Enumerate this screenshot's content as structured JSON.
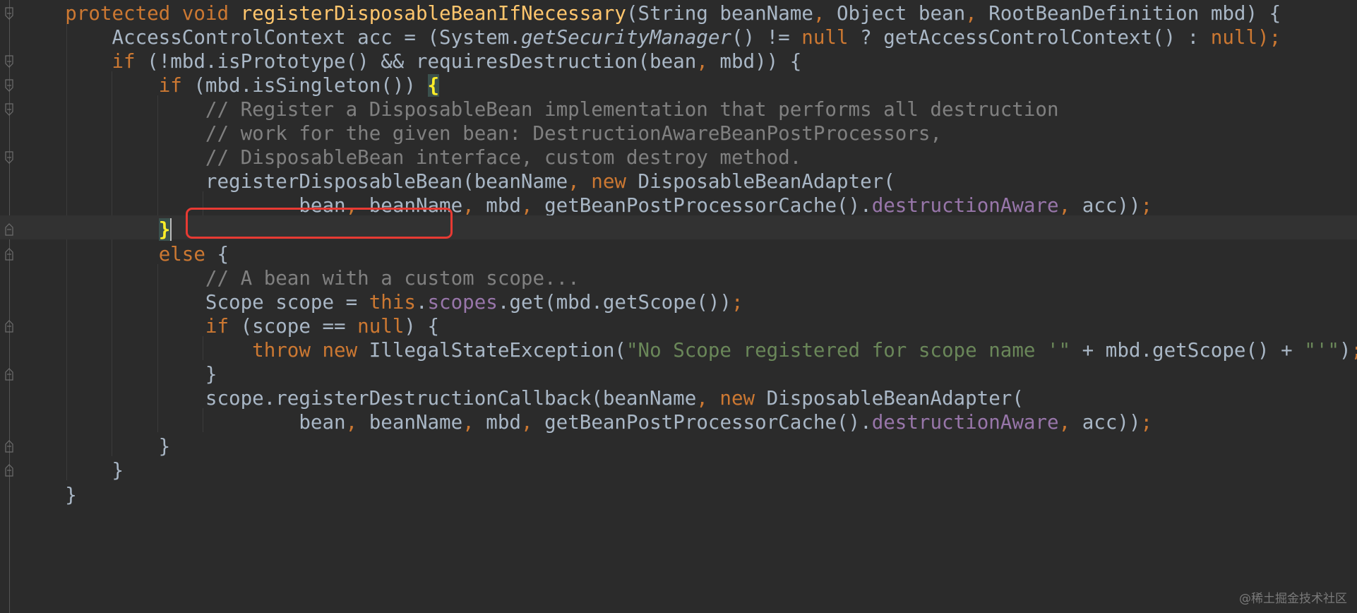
{
  "editor": {
    "lines": [
      [
        {
          "t": "    "
        },
        {
          "t": "protected void ",
          "c": "kw"
        },
        {
          "t": "registerDisposableBeanIfNecessary",
          "c": "fn"
        },
        {
          "t": "(String beanName"
        },
        {
          "t": ", ",
          "c": "kw"
        },
        {
          "t": "Object bean"
        },
        {
          "t": ", ",
          "c": "kw"
        },
        {
          "t": "RootBeanDefinition mbd) {"
        }
      ],
      [
        {
          "t": "        AccessControlContext acc = (System."
        },
        {
          "t": "getSecurityManager",
          "c": "it"
        },
        {
          "t": "() != "
        },
        {
          "t": "null ",
          "c": "kw"
        },
        {
          "t": "? getAccessControlContext() : "
        },
        {
          "t": "null",
          "c": "kw"
        },
        {
          "t": ");",
          "c": "kw"
        }
      ],
      [
        {
          "t": "        "
        },
        {
          "t": "if ",
          "c": "kw"
        },
        {
          "t": "(!mbd.isPrototype() && requiresDestruction(bean"
        },
        {
          "t": ", ",
          "c": "kw"
        },
        {
          "t": "mbd)) {"
        }
      ],
      [
        {
          "t": "            "
        },
        {
          "t": "if ",
          "c": "kw"
        },
        {
          "t": "(mbd.isSingleton()) "
        },
        {
          "t": "{",
          "c": "brace-hl"
        }
      ],
      [
        {
          "t": "                "
        },
        {
          "t": "// Register a DisposableBean implementation that performs all destruction",
          "c": "cm"
        }
      ],
      [
        {
          "t": "                "
        },
        {
          "t": "// work for the given bean: DestructionAwareBeanPostProcessors,",
          "c": "cm"
        }
      ],
      [
        {
          "t": "                "
        },
        {
          "t": "// DisposableBean interface, custom destroy method.",
          "c": "cm"
        }
      ],
      [
        {
          "t": "                registerDisposableBean(beanName"
        },
        {
          "t": ", ",
          "c": "kw"
        },
        {
          "t": "new ",
          "c": "kw"
        },
        {
          "t": "DisposableBeanAdapter("
        }
      ],
      [
        {
          "t": "                        bean"
        },
        {
          "t": ", ",
          "c": "kw"
        },
        {
          "t": "beanName"
        },
        {
          "t": ", ",
          "c": "kw"
        },
        {
          "t": "mbd"
        },
        {
          "t": ", ",
          "c": "kw"
        },
        {
          "t": "getBeanPostProcessorCache()."
        },
        {
          "t": "destructionAware",
          "c": "fd"
        },
        {
          "t": ", ",
          "c": "kw"
        },
        {
          "t": "acc))"
        },
        {
          "t": ";",
          "c": "kw"
        }
      ],
      [
        {
          "t": "            "
        },
        {
          "t": "}",
          "c": "brace-hl"
        },
        {
          "t": "",
          "caret": true
        }
      ],
      [
        {
          "t": "            "
        },
        {
          "t": "else ",
          "c": "kw"
        },
        {
          "t": "{"
        }
      ],
      [
        {
          "t": "                "
        },
        {
          "t": "// A bean with a custom scope...",
          "c": "cm"
        }
      ],
      [
        {
          "t": "                Scope scope = "
        },
        {
          "t": "this",
          "c": "kw"
        },
        {
          "t": "."
        },
        {
          "t": "scopes",
          "c": "fd"
        },
        {
          "t": ".get(mbd.getScope())"
        },
        {
          "t": ";",
          "c": "kw"
        }
      ],
      [
        {
          "t": "                "
        },
        {
          "t": "if ",
          "c": "kw"
        },
        {
          "t": "(scope == "
        },
        {
          "t": "null",
          "c": "kw"
        },
        {
          "t": ") {"
        }
      ],
      [
        {
          "t": "                    "
        },
        {
          "t": "throw new ",
          "c": "kw"
        },
        {
          "t": "IllegalStateException("
        },
        {
          "t": "\"No Scope registered for scope name '\"",
          "c": "st"
        },
        {
          "t": " + mbd.getScope() + "
        },
        {
          "t": "\"'\"",
          "c": "st"
        },
        {
          "t": ")"
        },
        {
          "t": ";",
          "c": "kw"
        }
      ],
      [
        {
          "t": "                }"
        }
      ],
      [
        {
          "t": "                scope.registerDestructionCallback(beanName"
        },
        {
          "t": ", ",
          "c": "kw"
        },
        {
          "t": "new ",
          "c": "kw"
        },
        {
          "t": "DisposableBeanAdapter("
        }
      ],
      [
        {
          "t": "                        bean"
        },
        {
          "t": ", ",
          "c": "kw"
        },
        {
          "t": "beanName"
        },
        {
          "t": ", ",
          "c": "kw"
        },
        {
          "t": "mbd"
        },
        {
          "t": ", ",
          "c": "kw"
        },
        {
          "t": "getBeanPostProcessorCache()."
        },
        {
          "t": "destructionAware",
          "c": "fd"
        },
        {
          "t": ", ",
          "c": "kw"
        },
        {
          "t": "acc))"
        },
        {
          "t": ";",
          "c": "kw"
        }
      ],
      [
        {
          "t": "            }"
        }
      ],
      [
        {
          "t": "        }"
        }
      ],
      [
        {
          "t": "    }"
        }
      ]
    ],
    "fold_markers": [
      0,
      2,
      3,
      4,
      6,
      9,
      10,
      13,
      15,
      18,
      19
    ],
    "watermark": "@稀土掘金技术社区"
  },
  "colors": {
    "background": "#2b2b2b",
    "keyword": "#cc7832",
    "method": "#ffc66d",
    "comment": "#808080",
    "string": "#6a8759",
    "field": "#9876aa",
    "text": "#a9b7c6",
    "highlight_box": "#e83a33"
  }
}
